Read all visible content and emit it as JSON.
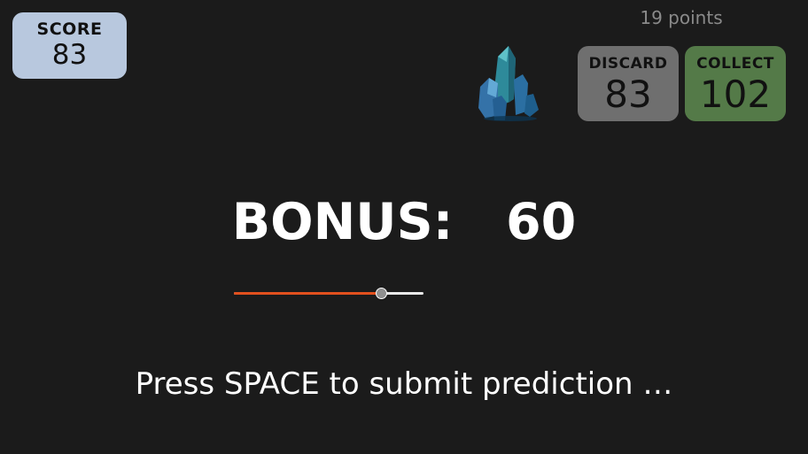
{
  "score": {
    "label": "SCORE",
    "value": "83"
  },
  "points": "19 points",
  "discard": {
    "label": "DISCARD",
    "value": "83"
  },
  "collect": {
    "label": "COLLECT",
    "value": "102"
  },
  "bonus": {
    "label": "BONUS:",
    "value": "60"
  },
  "slider": {
    "fraction": 0.78
  },
  "prompt": "Press SPACE to submit prediction …",
  "colors": {
    "background": "#1b1b1b",
    "score_card": "#b8c8de",
    "discard": "#6f6f6f",
    "collect": "#547a48",
    "slider_fill": "#e2501e"
  },
  "icons": {
    "item": "blue-crystal-icon"
  }
}
